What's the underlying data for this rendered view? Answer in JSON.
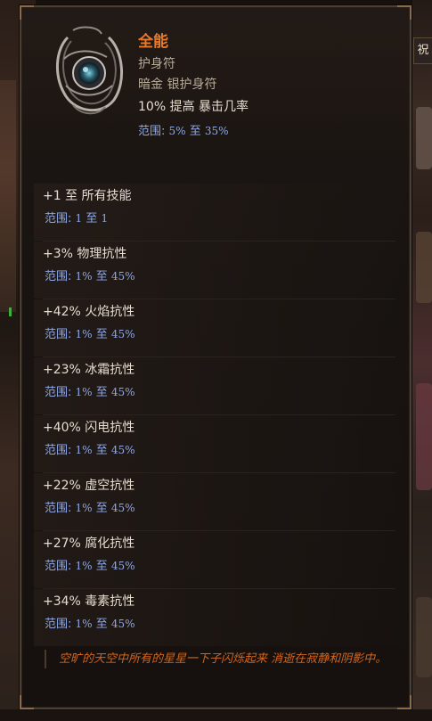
{
  "item": {
    "name": "全能",
    "type": "护身符",
    "rarity": "暗金 银护身符",
    "implicit": {
      "text": "10% 提高 暴击几率",
      "range_label": "范围:",
      "range_min": "5%",
      "range_sep": "至",
      "range_max": "35%"
    },
    "affixes": [
      {
        "text": "+1 至 所有技能",
        "range_label": "范围:",
        "range_min": "1",
        "range_sep": "至",
        "range_max": "1"
      },
      {
        "text": "+3% 物理抗性",
        "range_label": "范围:",
        "range_min": "1%",
        "range_sep": "至",
        "range_max": "45%"
      },
      {
        "text": "+42% 火焰抗性",
        "range_label": "范围:",
        "range_min": "1%",
        "range_sep": "至",
        "range_max": "45%"
      },
      {
        "text": "+23% 冰霜抗性",
        "range_label": "范围:",
        "range_min": "1%",
        "range_sep": "至",
        "range_max": "45%"
      },
      {
        "text": "+40% 闪电抗性",
        "range_label": "范围:",
        "range_min": "1%",
        "range_sep": "至",
        "range_max": "45%"
      },
      {
        "text": "+22% 虚空抗性",
        "range_label": "范围:",
        "range_min": "1%",
        "range_sep": "至",
        "range_max": "45%"
      },
      {
        "text": "+27% 腐化抗性",
        "range_label": "范围:",
        "range_min": "1%",
        "range_sep": "至",
        "range_max": "45%"
      },
      {
        "text": "+34% 毒素抗性",
        "range_label": "范围:",
        "range_min": "1%",
        "range_sep": "至",
        "range_max": "45%"
      }
    ],
    "flavor_text": "空旷的天空中所有的星星一下子闪烁起来 消逝在寂静和阴影中。",
    "icon": "amulet-icon"
  },
  "side_tab": {
    "label": "祝"
  },
  "colors": {
    "unique_name": "#e87a2a",
    "range": "#8ea8e8",
    "flavor": "#d0651e",
    "text": "#e6ddd0",
    "subtext": "#b8ab98"
  }
}
